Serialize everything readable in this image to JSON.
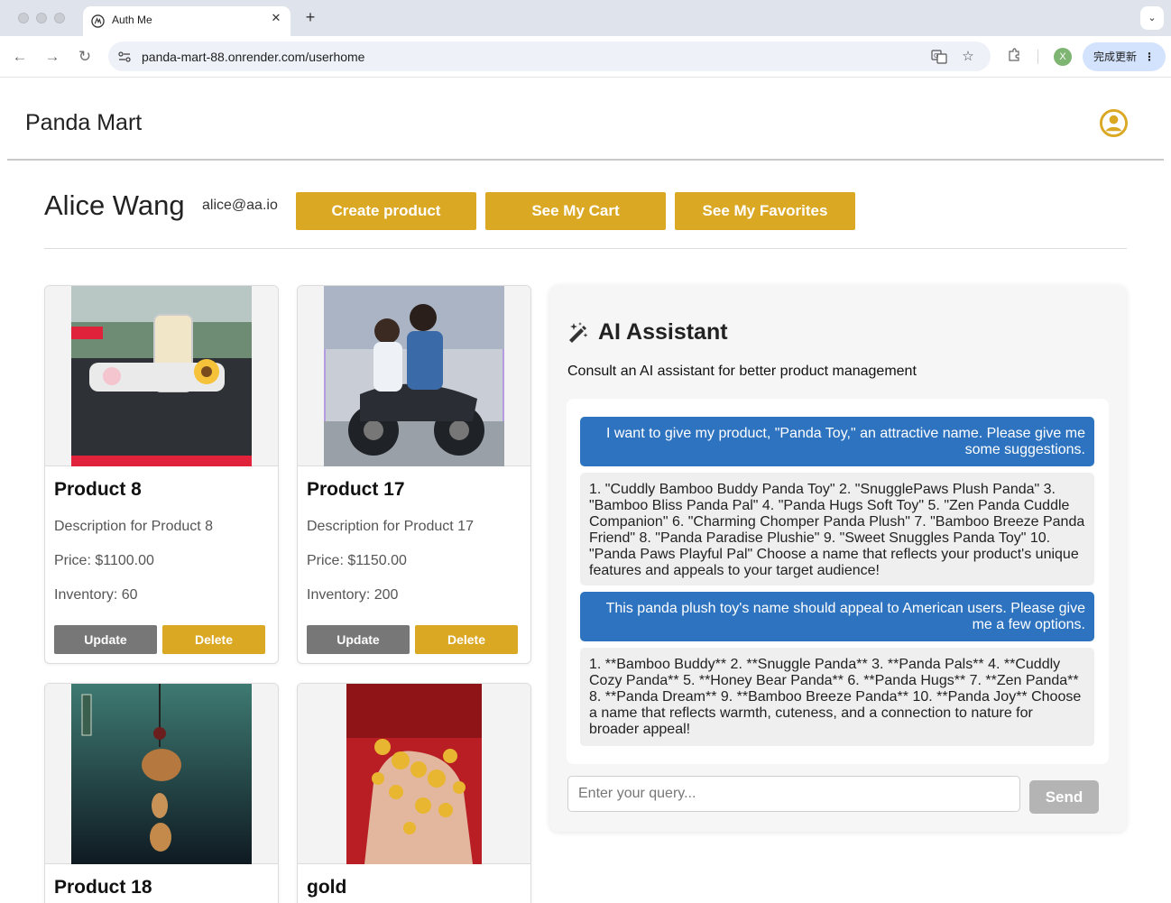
{
  "browser": {
    "tab_title": "Auth Me",
    "url": "panda-mart-88.onrender.com/userhome",
    "profile_initial": "X",
    "update_label": "完成更新"
  },
  "header": {
    "brand": "Panda Mart"
  },
  "profile": {
    "name": "Alice Wang",
    "email": "alice@aa.io",
    "buttons": [
      "Create product",
      "See My Cart",
      "See My Favorites"
    ]
  },
  "products": [
    {
      "title": "Product 8",
      "description": "Description for Product 8",
      "price": "Price: $1100.00",
      "inventory": "Inventory: 60",
      "update_label": "Update",
      "delete_label": "Delete"
    },
    {
      "title": "Product 17",
      "description": "Description for Product 17",
      "price": "Price: $1150.00",
      "inventory": "Inventory: 200",
      "update_label": "Update",
      "delete_label": "Delete"
    },
    {
      "title": "Product 18"
    },
    {
      "title": "gold"
    }
  ],
  "ai": {
    "title": "AI Assistant",
    "subtitle": "Consult an AI assistant for better product management",
    "messages": [
      {
        "role": "user",
        "text": "I want to give my product, \"Panda Toy,\" an attractive name. Please give me some suggestions."
      },
      {
        "role": "assistant",
        "text": "1. \"Cuddly Bamboo Buddy Panda Toy\" 2. \"SnugglePaws Plush Panda\" 3. \"Bamboo Bliss Panda Pal\" 4. \"Panda Hugs Soft Toy\" 5. \"Zen Panda Cuddle Companion\" 6. \"Charming Chomper Panda Plush\" 7. \"Bamboo Breeze Panda Friend\" 8. \"Panda Paradise Plushie\" 9. \"Sweet Snuggles Panda Toy\" 10. \"Panda Paws Playful Pal\" Choose a name that reflects your product's unique features and appeals to your target audience!"
      },
      {
        "role": "user",
        "text": "This panda plush toy's name should appeal to American users. Please give me a few options."
      },
      {
        "role": "assistant",
        "text": "1. **Bamboo Buddy** 2. **Snuggle Panda** 3. **Panda Pals** 4. **Cuddly Cozy Panda** 5. **Honey Bear Panda** 6. **Panda Hugs** 7. **Zen Panda** 8. **Panda Dream** 9. **Bamboo Breeze Panda** 10. **Panda Joy** Choose a name that reflects warmth, cuteness, and a connection to nature for broader appeal!"
      }
    ],
    "input_placeholder": "Enter your query...",
    "send_label": "Send"
  },
  "colors": {
    "accent": "#dba824",
    "user_bubble": "#2d73c0",
    "update_button": "#777777"
  }
}
